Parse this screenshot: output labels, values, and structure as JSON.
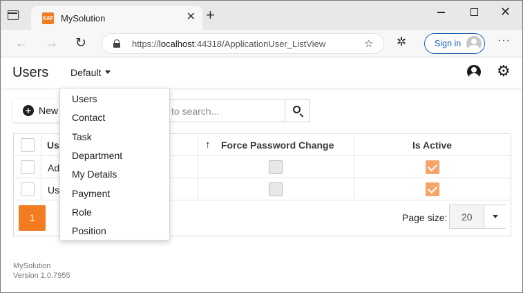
{
  "browser": {
    "tab_title": "MySolution",
    "tab_favicon_text": "XAF",
    "url_prefix": "https://",
    "url_host": "localhost",
    "url_rest": ":44318/ApplicationUser_ListView",
    "signin_label": "Sign in",
    "icons": [
      "tab-actions-icon",
      "close-icon",
      "plus-icon",
      "minimize-icon",
      "maximize-icon",
      "close-icon",
      "back-icon",
      "forward-icon",
      "reload-icon",
      "lock-icon",
      "favorite-icon",
      "extensions-icon",
      "avatar",
      "more-icon"
    ]
  },
  "header": {
    "title": "Users",
    "view_variant": "Default"
  },
  "toolbar": {
    "new_label": "New",
    "search_placeholder": "to search..."
  },
  "grid": {
    "columns": [
      "Us",
      "Force Password Change",
      "Is Active"
    ],
    "rows": [
      {
        "name": "Ad",
        "force_password_change": false,
        "is_active": true
      },
      {
        "name": "Us",
        "force_password_change": false,
        "is_active": true
      }
    ],
    "current_page": "1",
    "page_size_label": "Page size:",
    "page_size_value": "20"
  },
  "dropdown": {
    "items": [
      "Users",
      "Contact",
      "Task",
      "Department",
      "My Details",
      "Payment",
      "Role",
      "Position"
    ]
  },
  "footer": {
    "app_name": "MySolution",
    "version": "Version 1.0.7955"
  },
  "colors": {
    "accent": "#f47c20",
    "check_active": "#f6a46a",
    "link_blue": "#1a5fb4"
  }
}
